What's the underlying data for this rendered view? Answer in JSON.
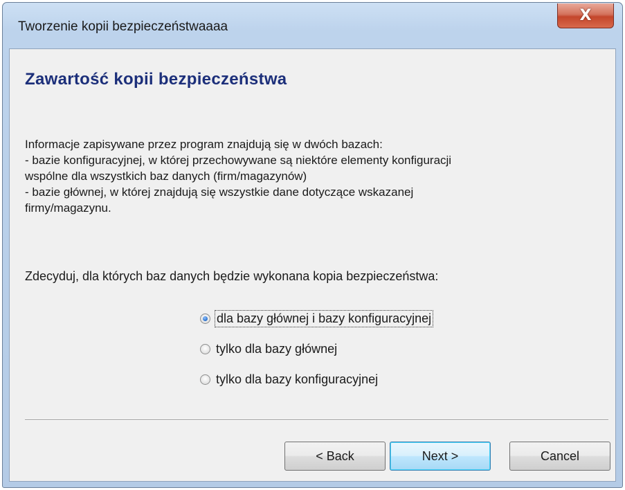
{
  "window": {
    "title": "Tworzenie kopii bezpieczeństwaaaa",
    "close_label": "X"
  },
  "page": {
    "heading": "Zawartość kopii bezpieczeństwa",
    "info_lines": [
      "Informacje zapisywane przez program znajdują się w dwóch bazach:",
      "- bazie konfiguracyjnej, w której przechowywane są niektóre elementy konfiguracji",
      "wspólne dla wszystkich baz danych (firm/magazynów)",
      "- bazie głównej, w której znajdują się wszystkie dane dotyczące wskazanej",
      "firmy/magazynu."
    ],
    "question": "Zdecyduj, dla których baz danych będzie wykonana kopia bezpieczeństwa:"
  },
  "options": [
    {
      "label": "dla bazy głównej i bazy konfiguracyjnej",
      "checked": true
    },
    {
      "label": "tylko dla bazy głównej",
      "checked": false
    },
    {
      "label": "tylko dla bazy konfiguracyjnej",
      "checked": false
    }
  ],
  "buttons": {
    "back": "< Back",
    "next": "Next >",
    "cancel": "Cancel"
  },
  "colors": {
    "heading": "#1c2f7a",
    "close_button": "#c4462b",
    "default_button_border": "#3c7fb1"
  }
}
